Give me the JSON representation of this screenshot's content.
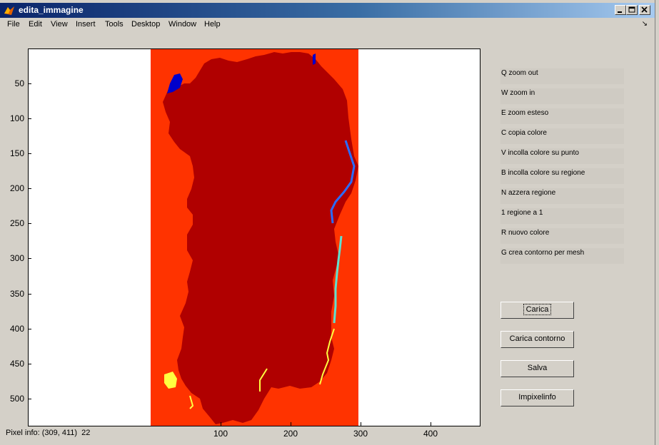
{
  "window": {
    "title": "edita_immagine",
    "caption_buttons": [
      "minimize",
      "maximize",
      "close"
    ]
  },
  "menu": [
    "File",
    "Edit",
    "View",
    "Insert",
    "Tools",
    "Desktop",
    "Window",
    "Help"
  ],
  "axes": {
    "y_ticks": [
      "50",
      "100",
      "150",
      "200",
      "250",
      "300",
      "350",
      "400",
      "450",
      "500"
    ],
    "x_ticks": [
      "100",
      "200",
      "300",
      "400"
    ]
  },
  "image_colors": {
    "background": "#ff3300",
    "land": "#b00000",
    "axes_bg": "#ffffff",
    "coast_blue": "#0000cc",
    "coast_lightblue": "#2a6cff",
    "coast_cyan": "#5fe0d0",
    "coast_yellow": "#ffff40"
  },
  "shortcuts": [
    "Q zoom out",
    "W zoom in",
    "E zoom esteso",
    "C copia colore",
    "V incolla colore su punto",
    "B incolla colore su regione",
    "N azzera regione",
    "1 regione a 1",
    "R nuovo colore",
    "G crea contorno per mesh"
  ],
  "buttons": {
    "carica": "Carica",
    "carica_contorno": "Carica contorno",
    "salva": "Salva",
    "impixelinfo": "Impixelinfo"
  },
  "status": {
    "pixel_info": "Pixel info: (309, 411)  22"
  }
}
